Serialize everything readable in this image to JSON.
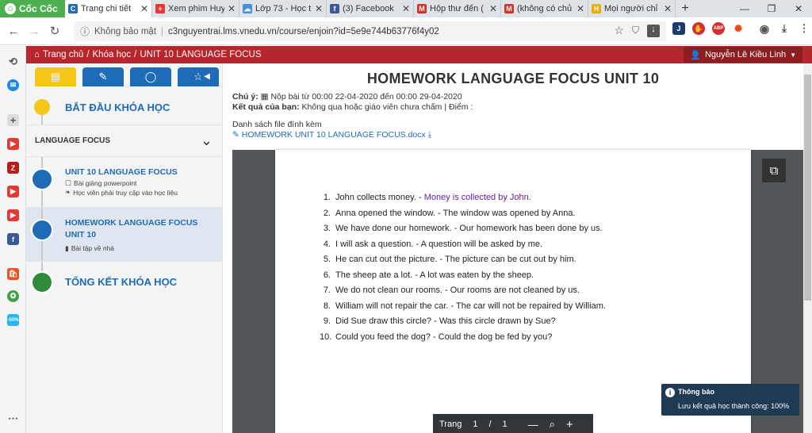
{
  "browser": {
    "brand": "Cốc Cốc",
    "tabs": [
      {
        "label": "Trang chi tiết",
        "active": true,
        "fav": "C",
        "color": "#1e6bb8"
      },
      {
        "label": "Xem phim Huy",
        "active": false,
        "fav": "+",
        "color": "#e53935"
      },
      {
        "label": "Lớp 73 - Học t",
        "active": false,
        "fav": "☁",
        "color": "#4a90d9"
      },
      {
        "label": "(3) Facebook",
        "active": false,
        "fav": "f",
        "color": "#3b5998"
      },
      {
        "label": "Hộp thư đến (",
        "active": false,
        "fav": "M",
        "color": "#d93025"
      },
      {
        "label": "(không có chủ",
        "active": false,
        "fav": "M",
        "color": "#d93025"
      },
      {
        "label": "Mọi người chỉ",
        "active": false,
        "fav": "H",
        "color": "#f2a900"
      }
    ],
    "security": "Không bảo mật",
    "url": "c3nguyentrai.lms.vnedu.vn/course/enjoin?id=5e9e744b63776f4y02"
  },
  "site": {
    "breadcrumb": [
      "Trang chủ",
      "Khóa học",
      "UNIT 10 LANGUAGE FOCUS"
    ],
    "user": "Nguyễn Lê Kiều Linh"
  },
  "sidebar": {
    "start": "BẮT ĐẦU KHÓA HỌC",
    "section": "LANGUAGE FOCUS",
    "items": [
      {
        "title": "UNIT 10 LANGUAGE FOCUS",
        "sub1": "Bài giảng powerpoint",
        "sub2": "Học viên phải truy cập vào học liệu"
      },
      {
        "title": "HOMEWORK LANGUAGE FOCUS UNIT 10",
        "sub1": "Bài tập về nhà"
      }
    ],
    "end": "TỔNG KẾT KHÓA HỌC"
  },
  "main": {
    "title": "HOMEWORK LANGUAGE FOCUS UNIT 10",
    "note_label": "Chú ý:",
    "note_text": "Nộp bài từ 00:00 22-04-2020 đến 00:00 29-04-2020",
    "result_label": "Kết quả của bạn:",
    "result_text": "Không qua hoặc giáo viên chưa chấm | Điểm :",
    "files_label": "Danh sách file đính kèm",
    "file_name": "HOMEWORK UNIT 10 LANGUAGE FOCUS.docx"
  },
  "document": {
    "lines": [
      {
        "n": "1.",
        "a": "John collects money. - ",
        "b": "Money is collected by John."
      },
      {
        "n": "2.",
        "a": "Anna opened the window. - The window was opened by Anna.",
        "b": ""
      },
      {
        "n": "3.",
        "a": "We have done our homework. - Our homework has been done by us.",
        "b": ""
      },
      {
        "n": "4.",
        "a": "I will ask a question. - A question will be asked by me.",
        "b": ""
      },
      {
        "n": "5.",
        "a": "He can cut out the picture. - The picture can be cut out by him.",
        "b": ""
      },
      {
        "n": "6.",
        "a": "The sheep ate a lot. - A lot was eaten by the sheep.",
        "b": ""
      },
      {
        "n": "7.",
        "a": "We do not clean our rooms. - Our rooms are not cleaned by us.",
        "b": ""
      },
      {
        "n": "8.",
        "a": "William will not repair the car. - The car will not be repaired by William.",
        "b": ""
      },
      {
        "n": "9.",
        "a": "Did Sue draw this circle? - Was this circle drawn by Sue?",
        "b": ""
      },
      {
        "n": "10.",
        "a": "Could you feed the dog? - Could the dog be fed by you?",
        "b": ""
      }
    ],
    "pager_label": "Trang",
    "page": "1",
    "slash": "/",
    "total": "1"
  },
  "toast": {
    "title": "Thông báo",
    "message": "Lưu kết quả học thành công: 100%"
  }
}
